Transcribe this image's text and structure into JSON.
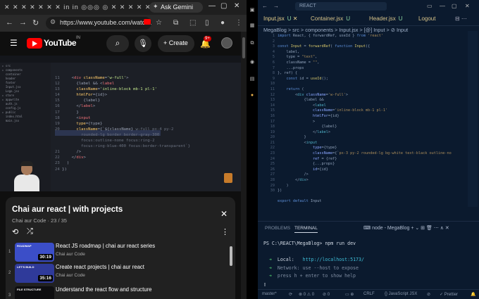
{
  "browser": {
    "gemini_label": "Ask Gemini",
    "url": "https://www.youtube.com/watch...",
    "window_controls": [
      "—",
      "▢",
      "✕"
    ]
  },
  "youtube": {
    "logo_text": "YouTube",
    "region": "IN",
    "create_label": "Create",
    "notif_count": "9+"
  },
  "video": {
    "code_lines": [
      "11",
      "12",
      "13",
      "14",
      "15",
      "16",
      "17",
      "18",
      "19",
      "20",
      "",
      "",
      "",
      "",
      "21",
      "22",
      "23",
      "24",
      "25"
    ]
  },
  "playlist": {
    "title": "Chai aur react | with projects",
    "subtitle": "Chai aur Code · 23 / 35",
    "items": [
      {
        "index": "1",
        "thumb_text": "ROADMAP",
        "duration": "30:19",
        "title": "React JS roadmap | chai aur react series",
        "author": "Chai aur Code"
      },
      {
        "index": "2",
        "thumb_text": "LET'S BUILD",
        "duration": "35:16",
        "title": "Create react projects | chai aur react",
        "author": "Chai aur Code"
      },
      {
        "index": "3",
        "thumb_text": "FILE STRUCTURE",
        "duration": "",
        "title": "Understand the react flow and structure",
        "author": ""
      }
    ]
  },
  "vscode": {
    "search_label": "REACT",
    "tabs": [
      {
        "label": "Input.jsx",
        "state": "U"
      },
      {
        "label": "Container.jsx",
        "state": "U"
      },
      {
        "label": "Header.jsx",
        "state": "U"
      },
      {
        "label": "Logout",
        "state": ""
      }
    ],
    "breadcrumb": "MegaBlog > src > components > Input.jsx > [@] Input > ⊘ Input",
    "panel_tabs": [
      "PROBLEMS",
      "TERMINAL"
    ],
    "panel_tool_label": "node - MegaBlog",
    "terminal": {
      "prompt": "PS C:\\REACT\\MegaBlog> npm run dev",
      "local_label": "Local:",
      "local_url": "http://localhost:5173/",
      "network": "Network: use --host to expose",
      "help": "press h + enter to show help"
    },
    "status": {
      "branch": "master*",
      "errors": "⊗ 0 ⚠ 0",
      "ports": "⊘ 0",
      "eol": "CRLF",
      "lang": "{} JavaScript JSX",
      "prettier": "✓ Prettier"
    }
  }
}
